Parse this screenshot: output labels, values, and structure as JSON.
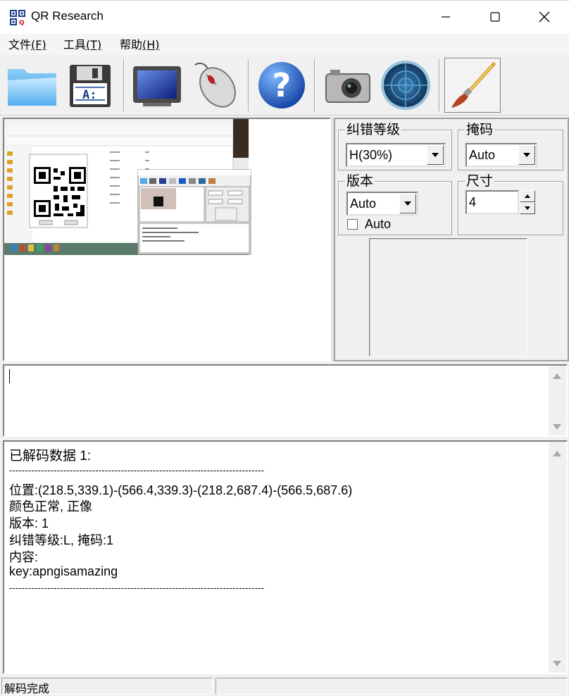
{
  "window": {
    "title": "QR Research"
  },
  "menu": [
    {
      "label": "文件",
      "mnemonic": "(F)"
    },
    {
      "label": "工具",
      "mnemonic": "(T)"
    },
    {
      "label": "帮助",
      "mnemonic": "(H)"
    }
  ],
  "toolbar": {
    "icons": [
      "folder-open-icon",
      "floppy-save-icon",
      "monitor-icon",
      "mouse-icon",
      "help-icon",
      "camera-icon",
      "radar-icon",
      "paintbrush-icon"
    ]
  },
  "settings": {
    "ecl": {
      "label": "纠错等级",
      "value": "H(30%)"
    },
    "mask": {
      "label": "掩码",
      "value": "Auto"
    },
    "version": {
      "label": "版本",
      "value": "Auto",
      "auto_label": "Auto"
    },
    "size": {
      "label": "尺寸",
      "value": "4"
    }
  },
  "input": {
    "value": ""
  },
  "output": {
    "header": "已解码数据 1:",
    "separator": "--------------------------------------------------------------------------------",
    "position": "位置:(218.5,339.1)-(566.4,339.3)-(218.2,687.4)-(566.5,687.6)",
    "color": "颜色正常, 正像",
    "version": "版本: 1",
    "ecl_mask": "纠错等级:L, 掩码:1",
    "content_label": "内容:",
    "content": "key:apngisamazing",
    "separator_end": "--------------------------------------------------------------------------------"
  },
  "status": {
    "text": "解码完成"
  },
  "colors": {
    "accent_blue": "#1a4fa0",
    "window_bg": "#f0f0f0"
  }
}
